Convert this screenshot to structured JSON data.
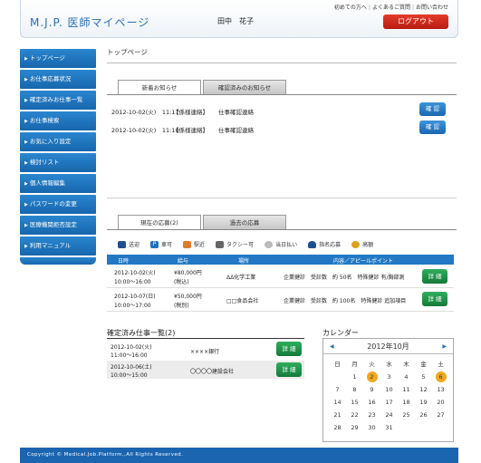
{
  "header": {
    "logo": "M.J.P. 医師マイページ",
    "username": "田中　花子",
    "links": [
      "初めての方へ",
      "よくあるご質問",
      "お問い合わせ"
    ],
    "logout": "ログアウト"
  },
  "sidebar": {
    "items": [
      {
        "label": "トップページ"
      },
      {
        "label": "お仕事応募状況"
      },
      {
        "label": "確定済みお仕事一覧"
      },
      {
        "label": "お仕事検索"
      },
      {
        "label": "お気に入り設定"
      },
      {
        "label": "検討リスト"
      },
      {
        "label": "個人情報編集"
      },
      {
        "label": "パスワードの変更"
      },
      {
        "label": "医療機関拒否設定"
      },
      {
        "label": "利用マニュアル"
      }
    ]
  },
  "main": {
    "page_title": "トップページ",
    "news_tabs": [
      "新着お知らせ",
      "確認済みのお知らせ"
    ],
    "news": [
      {
        "date": "2012-10-02(火)　11:17",
        "tag": "【係様連絡】",
        "subject": "仕事確認連絡",
        "button": "確 認"
      },
      {
        "date": "2012-10-02(火)　11:10",
        "tag": "【係様連絡】",
        "subject": "仕事確認連絡",
        "button": "確 認"
      }
    ],
    "app_tabs": [
      "現在の応募(2)",
      "過去の応募"
    ],
    "legend": [
      "送迎",
      "車可",
      "駅近",
      "タクシー可",
      "当日払い",
      "指名応募",
      "高額"
    ],
    "app_headers": [
      "日時",
      "給与",
      "場所",
      "内容／アピールポイント"
    ],
    "applications": [
      {
        "date": "2012-10-02(火)",
        "time": "10:00～16:00",
        "pay": "¥80,000円",
        "pay_note": "(税込)",
        "place": "ΔΔ化学工業",
        "content": "企業健診　受診数　約 50名　特殊健診 有/胸部測",
        "button": "詳 細"
      },
      {
        "date": "2012-10-07(日)",
        "time": "10:00～17:00",
        "pay": "¥50,000円",
        "pay_note": "(税別)",
        "place": "□□食品会社",
        "content": "企業健診　受診数　約 100名　特殊健診 追加項目",
        "button": "詳 細"
      }
    ],
    "confirmed_title": "確定済み仕事一覧(2)",
    "confirmed": [
      {
        "date": "2012-10-02(火)",
        "time": "11:00～16:00",
        "place": "××××銀行",
        "button": "詳 細"
      },
      {
        "date": "2012-10-06(土)",
        "time": "10:00～15:00",
        "place": "〇〇〇〇建設会社",
        "button": "詳 細"
      }
    ],
    "calendar": {
      "title": "カレンダー",
      "prev": "◀",
      "next": "▶",
      "month": "2012年10月",
      "weekdays": [
        "日",
        "月",
        "火",
        "水",
        "木",
        "金",
        "土"
      ],
      "days": [
        "",
        "1",
        "2",
        "3",
        "4",
        "5",
        "6",
        "7",
        "8",
        "9",
        "10",
        "11",
        "12",
        "13",
        "14",
        "15",
        "16",
        "17",
        "18",
        "19",
        "20",
        "21",
        "22",
        "23",
        "24",
        "25",
        "26",
        "27",
        "28",
        "29",
        "30",
        "31"
      ],
      "highlighted": [
        "2",
        "6"
      ],
      "highlight_color": "#f0a81e"
    }
  },
  "footer": "Copyright © Medical.Job.Platform.,All Rights Reserved.",
  "colors": {
    "accent": "#1f72bd",
    "logout": "#cc2418",
    "detail": "#1e8a48"
  }
}
